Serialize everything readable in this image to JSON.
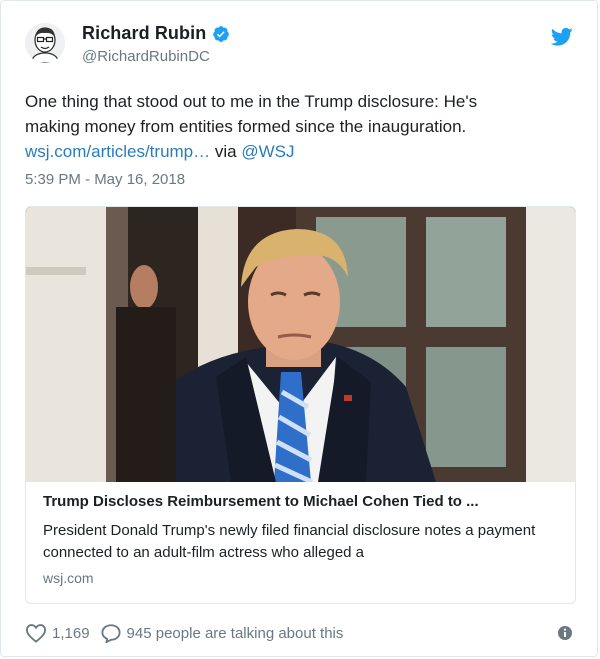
{
  "author": {
    "display_name": "Richard Rubin",
    "handle": "@RichardRubinDC"
  },
  "tweet": {
    "text_line1": "One thing that stood out to me in the Trump disclosure: He's",
    "text_line2": "making money from entities formed since the inauguration.",
    "link_text": "wsj.com/articles/trump…",
    "via_text": "via",
    "mention": "@WSJ",
    "timestamp": "5:39 PM - May 16, 2018"
  },
  "card": {
    "title": "Trump Discloses Reimbursement to Michael Cohen Tied to ...",
    "description": "President Donald Trump's newly filed financial disclosure notes a payment connected to an adult-film actress who alleged a",
    "domain": "wsj.com"
  },
  "actions": {
    "like_count": "1,169",
    "talking_text": "945 people are talking about this"
  },
  "icons": {
    "avatar": "avatar-illustration",
    "verified": "verified-badge-icon",
    "brand": "twitter-bird-icon",
    "like": "heart-icon",
    "reply": "speech-bubble-icon",
    "info": "info-icon"
  },
  "colors": {
    "twitter_blue": "#1da1f2",
    "link_blue": "#2b7bb9",
    "muted_gray": "#697882",
    "border": "#e1e8ed"
  }
}
